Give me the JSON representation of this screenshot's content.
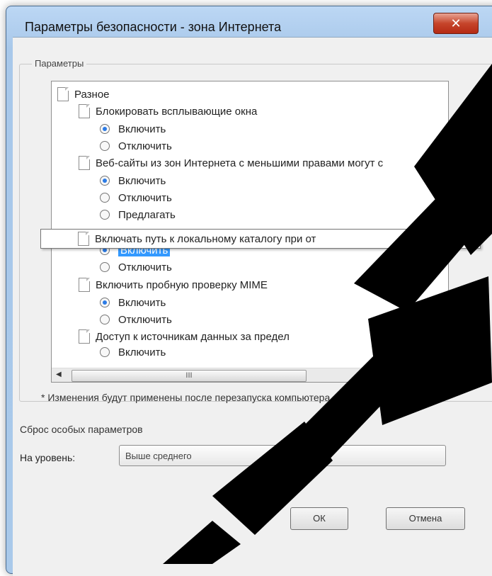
{
  "window": {
    "title": "Параметры безопасности - зона Интернета",
    "close_label": "✕"
  },
  "group": {
    "legend": "Параметры"
  },
  "settings_list": {
    "category": "Разное",
    "items": [
      {
        "label": "Блокировать всплывающие окна",
        "options": [
          {
            "label": "Включить",
            "selected": true
          },
          {
            "label": "Отключить",
            "selected": false
          }
        ]
      },
      {
        "label": "Веб-сайты из зон Интернета с меньшими правами могут с",
        "options": [
          {
            "label": "Включить",
            "selected": true
          },
          {
            "label": "Отключить",
            "selected": false
          },
          {
            "label": "Предлагать",
            "selected": false
          }
        ]
      },
      {
        "label": "Включать путь к локальному каталогу при от",
        "options": [
          {
            "label": "Включить",
            "selected": true
          },
          {
            "label": "Отключить",
            "selected": false
          }
        ]
      },
      {
        "label": "Включить пробную проверку MIME",
        "options": [
          {
            "label": "Включить",
            "selected": true
          },
          {
            "label": "Отключить",
            "selected": false
          }
        ]
      },
      {
        "label": "Доступ к источникам данных за предел",
        "options": [
          {
            "label": "Включить",
            "selected": false
          }
        ]
      }
    ],
    "hscroll_thumb": "III"
  },
  "note": "* Изменения будут применены после перезапуска компьютера",
  "reset": {
    "title": "Сброс особых параметров",
    "level_label": "На уровень:",
    "level_value": "Выше среднего"
  },
  "buttons": {
    "ok": "ОК",
    "cancel": "Отмена"
  }
}
